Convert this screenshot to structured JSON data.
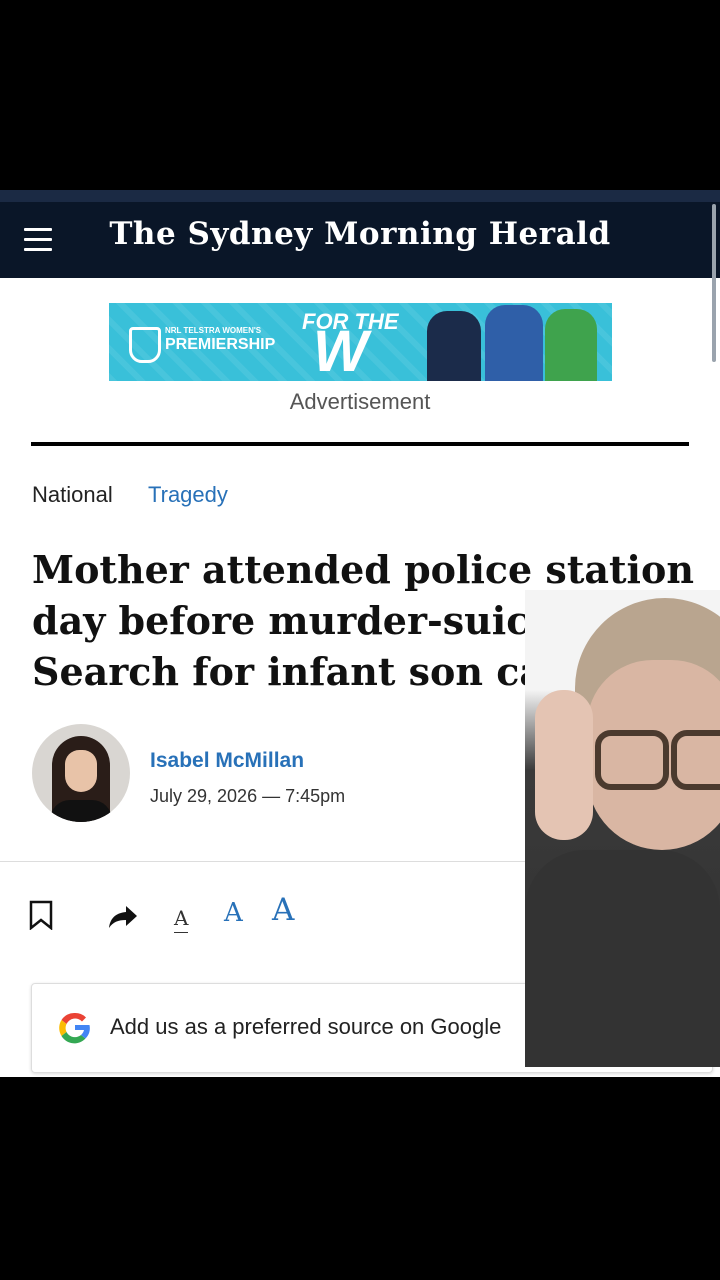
{
  "header": {
    "title": "The Sydney Morning Herald",
    "menu_icon": "hamburger-menu-icon"
  },
  "ad": {
    "league": "NRL TELSTRA WOMEN'S",
    "premiership": "PREMIERSHIP",
    "for_the": "FOR THE",
    "w": "W",
    "label": "Advertisement",
    "colors": {
      "background": "#39c0d9"
    }
  },
  "breadcrumb": {
    "section": "National",
    "topic": "Tragedy"
  },
  "article": {
    "headline_lines": [
      "Mother attended police station",
      "day before murder-suicide;",
      "Search for infant son called o"
    ],
    "author": "Isabel McMillan",
    "date": "July 29, 2026 — 7:45pm"
  },
  "toolbar": {
    "bookmark_icon": "bookmark-icon",
    "share_icon": "share-icon",
    "font_small": "A",
    "font_medium": "A",
    "font_large": "A"
  },
  "google_cta": {
    "text": "Add us as a preferred source on Google",
    "icon": "google-icon"
  },
  "colors": {
    "header_bg": "#0a1628",
    "link": "#2871b8"
  }
}
